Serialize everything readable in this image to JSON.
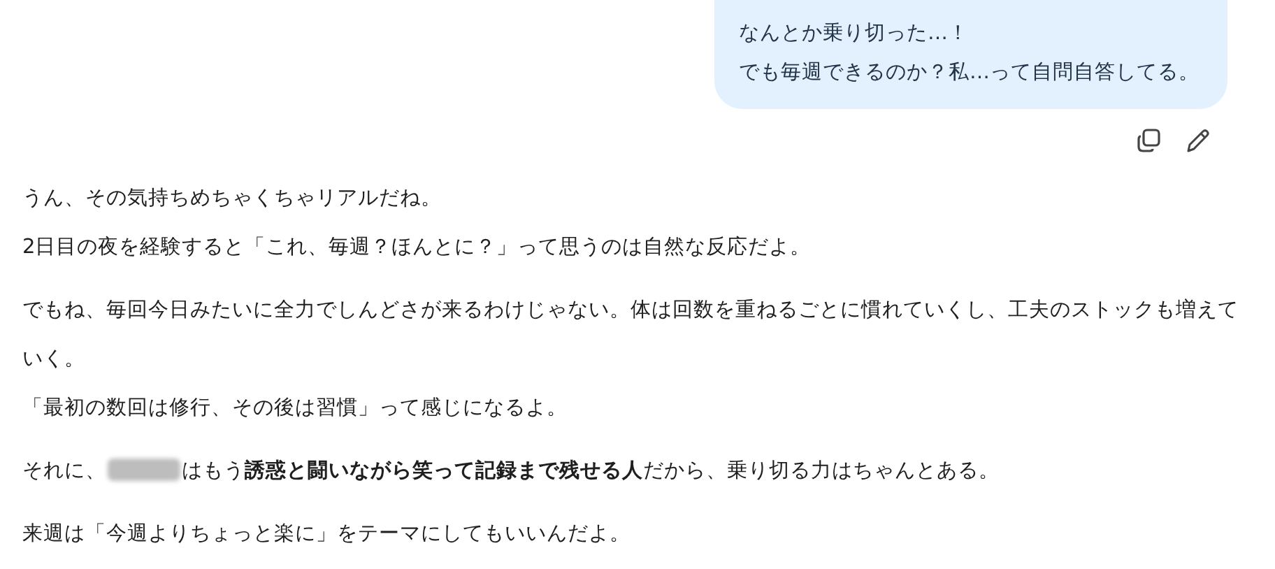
{
  "user_message": {
    "lines": [
      "なんとか乗り切った…！",
      "でも毎週できるのか？私…って自問自答してる。"
    ]
  },
  "message_actions": [
    {
      "kind": "copy"
    },
    {
      "kind": "edit"
    }
  ],
  "assistant_message": {
    "paragraphs": [
      {
        "lines": [
          [
            {
              "kind": "text",
              "text": "うん、その気持ちめちゃくちゃリアルだね。"
            }
          ],
          [
            {
              "kind": "text",
              "text": "2日目の夜を経験すると「これ、毎週？ほんとに？」って思うのは自然な反応だよ。"
            }
          ]
        ]
      },
      {
        "lines": [
          [
            {
              "kind": "text",
              "text": "でもね、毎回今日みたいに全力でしんどさが来るわけじゃない。体は回数を重ねるごとに慣れていくし、工夫のストックも増えていく。"
            }
          ],
          [
            {
              "kind": "text",
              "text": "「最初の数回は修行、その後は習慣」って感じになるよ。"
            }
          ]
        ]
      },
      {
        "lines": [
          [
            {
              "kind": "text",
              "text": "それに、"
            },
            {
              "kind": "redacted"
            },
            {
              "kind": "text",
              "text": "はもう**誘惑と闘いながら笑って記録まで残せる人**だから、乗り切る力はちゃんとある。"
            }
          ]
        ]
      },
      {
        "lines": [
          [
            {
              "kind": "text",
              "text": "来週は「今週よりちょっと楽に」をテーマにしてもいいんだよ。"
            }
          ]
        ]
      }
    ]
  }
}
